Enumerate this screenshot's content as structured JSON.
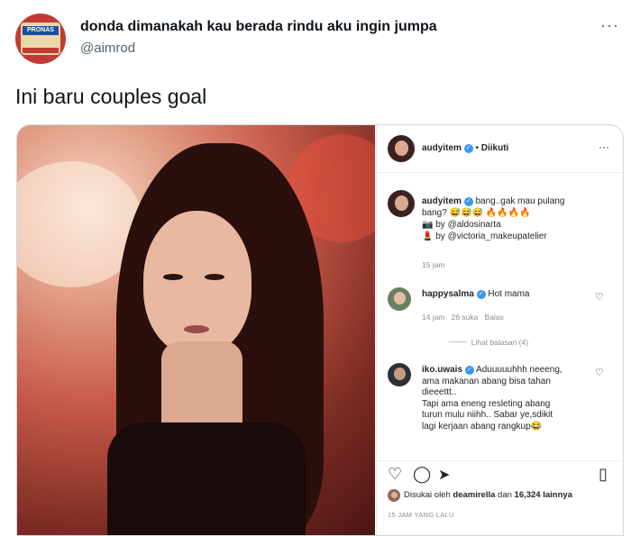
{
  "tweet": {
    "display_name": "donda dimanakah kau berada rindu aku ingin jumpa",
    "handle": "@aimrod",
    "more": "···",
    "text": "Ini baru couples goal",
    "avatar_text": "PRONAS"
  },
  "instagram": {
    "header": {
      "username": "audyitem",
      "separator": "•",
      "follow_label": "Diikuti",
      "more": "···"
    },
    "caption": {
      "username": "audyitem",
      "line1": "bang..gak mau pulang",
      "line2": "bang?",
      "emojis": "😅😅😅 🔥🔥🔥🔥",
      "credit1_icon": "📷",
      "credit1": "by @aldosinarta",
      "credit2_icon": "💄",
      "credit2": "by @victoria_makeupatelier",
      "time": "15 jam"
    },
    "comments": [
      {
        "username": "happysalma",
        "text": "Hot mama",
        "time": "14 jam",
        "likes": "26 suka",
        "reply": "Balas",
        "view_replies": "Lihat balasan (4)"
      },
      {
        "username": "iko.uwais",
        "line1": "Aduuuuuhhh neeeng,",
        "line2": "ama makanan abang bisa tahan",
        "line3": "dieeettt..",
        "line4": "Tapi ama eneng resleting abang",
        "line5": "turun mulu niihh.. Sabar ye,sdikit",
        "line6": "lagi kerjaan abang rangkup😂"
      }
    ],
    "icons": [
      "heart-icon",
      "comment-icon",
      "share-icon",
      "bookmark-icon"
    ],
    "liked_prefix": "Disukai oleh",
    "liked_user": "deamirella",
    "liked_middle": "dan",
    "liked_count": "16,324 lainnya",
    "timestamp": "15 JAM YANG LALU"
  },
  "colors": {
    "verified": "#3897f0",
    "handle": "#536471",
    "meta": "#8e8e8e"
  }
}
